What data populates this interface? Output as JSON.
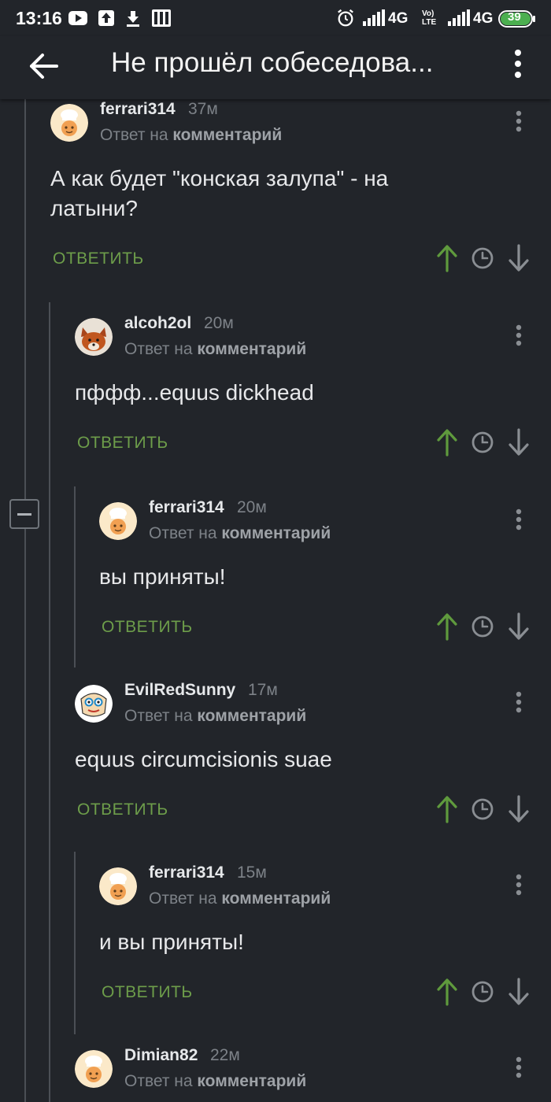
{
  "status_bar": {
    "time": "13:16",
    "network_1": "4G",
    "volte": "Vo) LTE",
    "network_2": "4G",
    "battery": "39"
  },
  "toolbar": {
    "title": "Не прошёл собеседова..."
  },
  "reply_label": "ОТВЕТИТЬ",
  "reply_to_prefix": "Ответ на",
  "reply_to_link": "комментарий",
  "colors": {
    "background": "#22252a",
    "reply_green": "#6d9d4a",
    "upvote_green": "#5f9a3d",
    "muted_text": "#7d8288"
  },
  "comments": [
    {
      "username": "ferrari314",
      "time": "37м",
      "body_lines": [
        "А как будет \"конская залупа\" - на",
        "латыни?"
      ],
      "avatar": "chef-avatar"
    },
    {
      "username": "alcoh2ol",
      "time": "20м",
      "body_lines": [
        "пффф...equus dickhead"
      ],
      "avatar": "fox-avatar"
    },
    {
      "username": "ferrari314",
      "time": "20м",
      "body_lines": [
        "вы приняты!"
      ],
      "avatar": "chef-avatar"
    },
    {
      "username": "EvilRedSunny",
      "time": "17м",
      "body_lines": [
        "equus circumcisionis suae"
      ],
      "avatar": "cartoon-avatar"
    },
    {
      "username": "ferrari314",
      "time": "15м",
      "body_lines": [
        "и вы приняты!"
      ],
      "avatar": "chef-avatar"
    },
    {
      "username": "Dimian82",
      "time": "22м",
      "body_lines": [],
      "avatar": "chef-avatar"
    }
  ]
}
